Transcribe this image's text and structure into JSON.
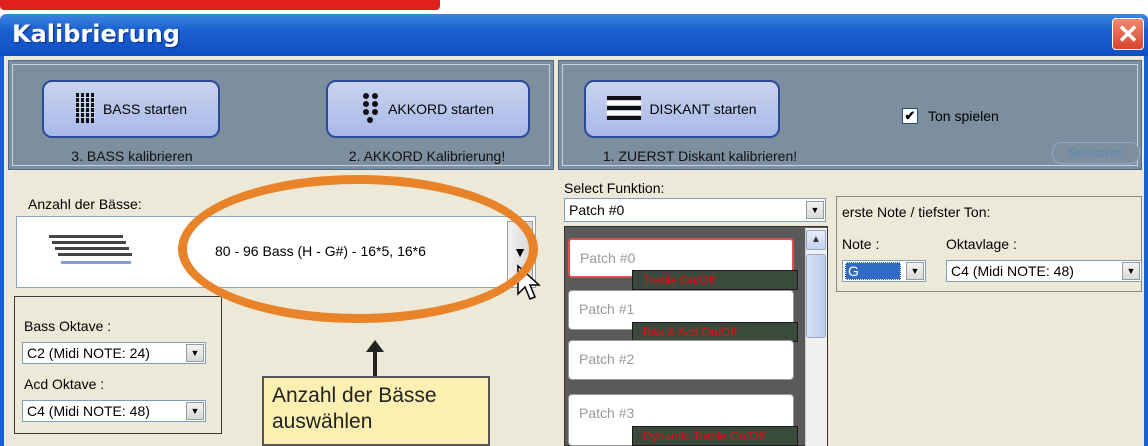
{
  "window": {
    "title": "Kalibrierung"
  },
  "left": {
    "bass_button": "BASS starten",
    "akkord_button": "AKKORD starten",
    "bass_caption": "3. BASS kalibrieren",
    "akkord_caption": "2. AKKORD Kalibrierung!",
    "anzahl_label": "Anzahl der Bässe:",
    "anzahl_value": "80 - 96 Bass (H - G#)  - 16*5, 16*6",
    "bass_oktave_label": "Bass Oktave :",
    "bass_oktave_value": "C2  (Midi NOTE: 24)",
    "acd_oktave_label": "Acd Oktave :",
    "acd_oktave_value": "C4  (Midi NOTE: 48)"
  },
  "right": {
    "diskant_button": "DISKANT starten",
    "diskant_caption": "1. ZUERST Diskant kalibrieren!",
    "ton_spielen_label": "Ton spielen",
    "ton_spielen_checked": true,
    "sensoren_button": "Sensoren",
    "select_funktion_label": "Select Funktion:",
    "select_funktion_value": "Patch #0",
    "patches": [
      "Patch #0",
      "Patch #1",
      "Patch #2",
      "Patch #3"
    ],
    "tags": [
      "Treble  On/Off",
      "Bas & Acd On/Off",
      "Dynamic Treble On/Off"
    ],
    "erste_note_label": "erste Note / tiefster Ton:",
    "note_label": "Note :",
    "note_value": "G",
    "oktavlage_label": "Oktavlage :",
    "oktavlage_value": "C4  (Midi NOTE: 48)"
  },
  "annotation": {
    "callout_line1": "Anzahl der Bässe",
    "callout_line2": "auswählen",
    "color": "#e8832a"
  }
}
